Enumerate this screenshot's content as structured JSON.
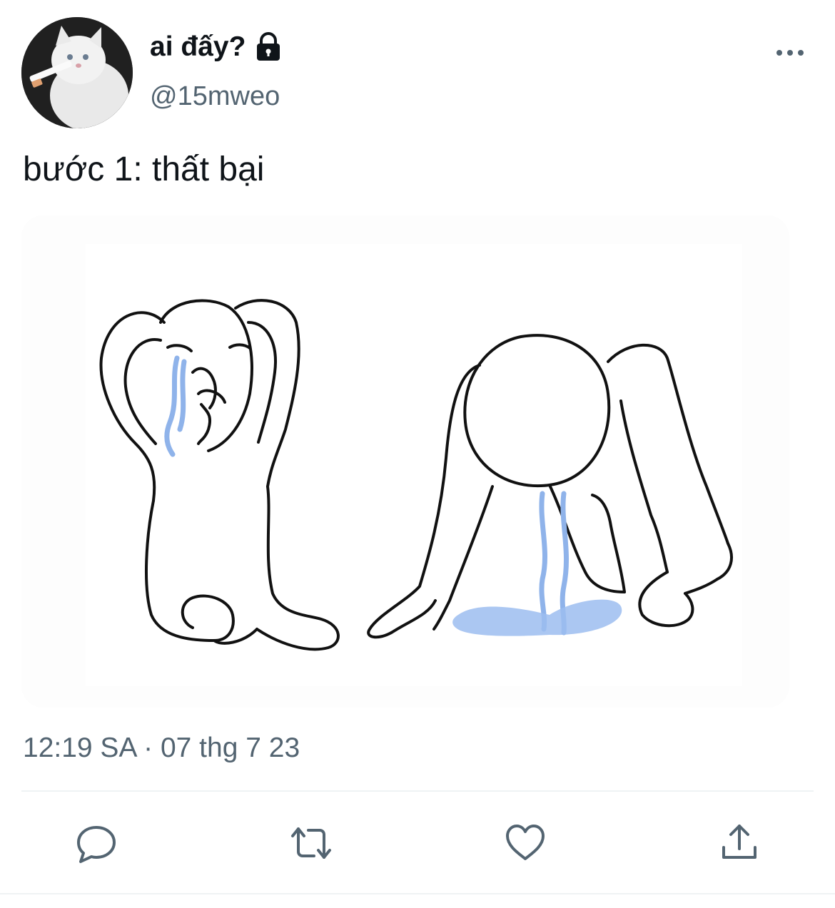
{
  "author": {
    "display_name": "ai đấy?",
    "handle": "@15mweo",
    "protected_icon": "lock-icon",
    "avatar_description_icon": "cat-avatar"
  },
  "tweet": {
    "text": "bước 1: thất bại",
    "timestamp": "12:19 SA · 07 thg 7 23"
  },
  "actions": {
    "reply_icon": "reply-icon",
    "retweet_icon": "retweet-icon",
    "like_icon": "heart-icon",
    "share_icon": "share-icon",
    "more_icon": "more-icon"
  },
  "colors": {
    "text": "#0f1419",
    "secondary": "#536471",
    "divider": "#eff3f4",
    "tears": "#8fb3ea"
  }
}
